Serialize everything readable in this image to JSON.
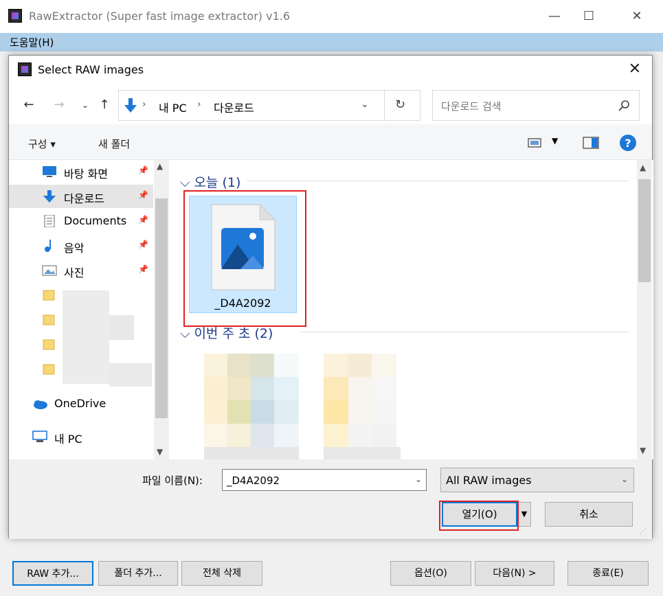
{
  "main": {
    "title": "RawExtractor (Super fast image extractor) v1.6",
    "menu_help": "도움말(H)",
    "buttons": {
      "add_raw": "RAW 추가...",
      "add_folder": "폴더 추가...",
      "delete_all": "전체 삭제",
      "options": "옵션(O)",
      "next": "다음(N) >",
      "exit": "종료(E)"
    }
  },
  "dialog": {
    "title": "Select RAW images",
    "breadcrumb": [
      "내 PC",
      "다운로드"
    ],
    "search_placeholder": "다운로드 검색",
    "toolbar": {
      "organize": "구성 ▾",
      "new_folder": "새 폴더"
    },
    "nav": {
      "items": [
        {
          "label": "바탕 화면",
          "icon": "desktop-icon",
          "pinned": true
        },
        {
          "label": "다운로드",
          "icon": "download-icon",
          "pinned": true,
          "selected": true
        },
        {
          "label": "Documents",
          "icon": "documents-icon",
          "pinned": true
        },
        {
          "label": "음악",
          "icon": "music-icon",
          "pinned": true
        },
        {
          "label": "사진",
          "icon": "pictures-icon",
          "pinned": true
        }
      ],
      "onedrive": "OneDrive",
      "this_pc": "내 PC"
    },
    "groups": [
      {
        "header": "오늘 (1)"
      },
      {
        "header": "이번 주 초 (2)"
      }
    ],
    "selected_file": "_D4A2092",
    "filename_label": "파일 이름(N):",
    "filename_value": "_D4A2092",
    "filetype_value": "All RAW images",
    "open_button": "열기(O)",
    "cancel_button": "취소"
  },
  "colors": {
    "accent": "#0078d7",
    "menubar": "#aecfea",
    "highlight_red": "#e02020",
    "group_header": "#1e3a8a"
  }
}
